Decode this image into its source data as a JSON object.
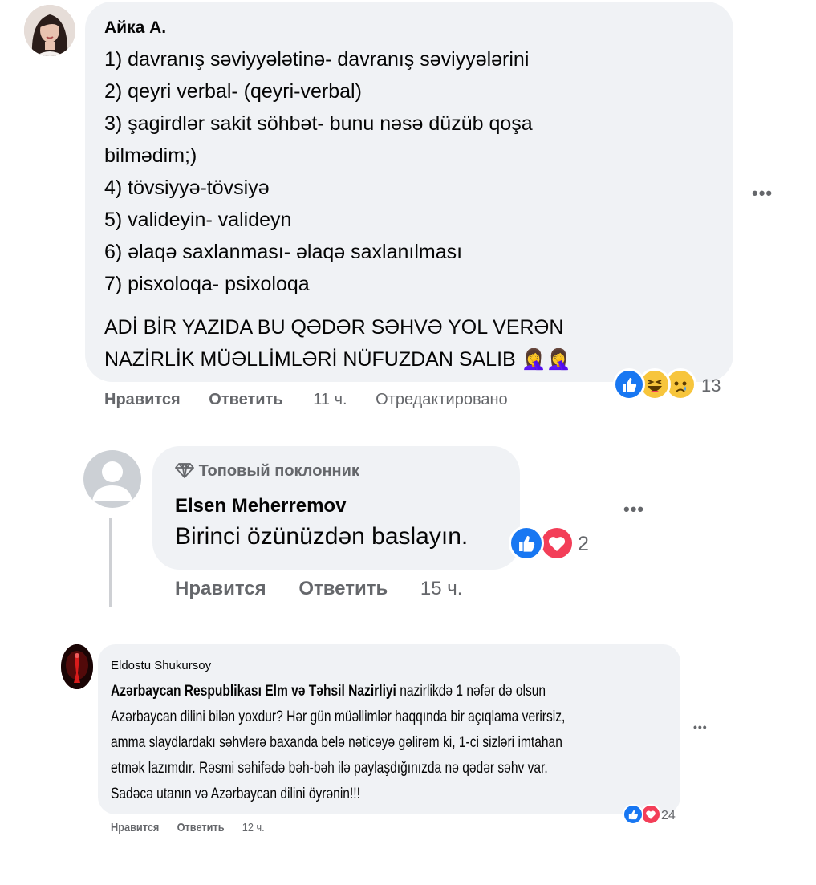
{
  "comments": [
    {
      "author": "Айка А.",
      "lines": [
        "1) davranış səviyyələtinə- davranış səviyyələrini",
        "2) qeyri verbal- (qeyri-verbal)",
        "3) şagirdlər sakit söhbət- bunu nəsə düzüb qoşa",
        "bilmədim;)",
        "4) tövsiyyə-tövsiyə",
        "5) valideyin- valideyn",
        "6) əlaqə saxlanması- əlaqə saxlanılması",
        "7) pisxoloqa- psixoloqa"
      ],
      "closing_lines": [
        "ADİ BİR YAZIDA BU QƏDƏR SƏHVƏ YOL VERƏN",
        "NAZİRLİK MÜƏLLİMLƏRİ NÜFUZDAN SALIB 🤦‍♀️🤦‍♀️"
      ],
      "reaction_icons": [
        "like-icon",
        "haha-icon",
        "sad-icon"
      ],
      "reaction_count": "13",
      "like_label": "Нравится",
      "reply_label": "Ответить",
      "time": "11 ч.",
      "edited_label": "Отредактировано"
    },
    {
      "badge": "Топовый поклонник",
      "author": "Elsen Meherremov",
      "text": "Birinci özünüzdən baslayın.",
      "reaction_icons": [
        "like-icon",
        "love-icon"
      ],
      "reaction_count": "2",
      "like_label": "Нравится",
      "reply_label": "Ответить",
      "time": "15 ч."
    },
    {
      "author": "Eldostu Shukursoy",
      "mention": "Azərbaycan Respublikası Elm və Təhsil Nazirliyi",
      "first_line_rest": " nazirlikdə 1 nəfər də olsun",
      "lines": [
        "Azərbaycan dilini bilən yoxdur? Hər gün müəllimlər haqqında bir açıqlama verirsiz,",
        "amma slaydlardakı səhvlərə baxanda belə nəticəyə gəlirəm ki, 1-ci sizləri imtahan",
        "etmək lazımdır. Rəsmi səhifədə bəh-bəh ilə paylaşdığınızda nə qədər səhv var.",
        "Sadəcə utanın və Azərbaycan dilini öyrənin!!!"
      ],
      "reaction_icons": [
        "like-icon",
        "love-icon"
      ],
      "reaction_count": "24",
      "like_label": "Нравится",
      "reply_label": "Ответить",
      "time": "12 ч."
    }
  ],
  "more_glyph": "•••",
  "colors": {
    "bubble": "#f0f2f5",
    "meta": "#65676b",
    "like": "#1877f2",
    "love": "#f33e58",
    "haha": "#f7c53c"
  }
}
